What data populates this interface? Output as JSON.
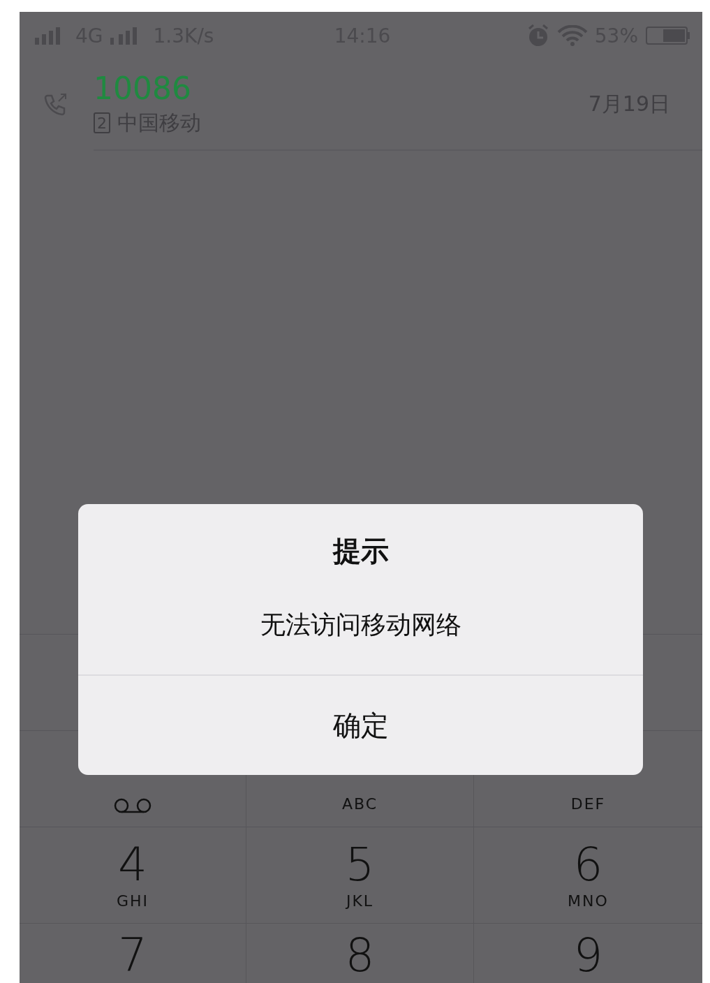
{
  "status_bar": {
    "network": "4G",
    "speed": "1.3K/s",
    "time": "14:16",
    "battery": "53%"
  },
  "call_log": [
    {
      "number": "10086",
      "sim": "2",
      "name": "中国移动",
      "date": "7月19日",
      "kind": "outgoing"
    }
  ],
  "keypad": [
    {
      "kind": "voicemail"
    },
    {
      "letters": "ABC",
      "kind": "digit"
    },
    {
      "letters": "DEF",
      "kind": "digit"
    },
    {
      "digit": "4",
      "letters": "GHI",
      "kind": "digit"
    },
    {
      "digit": "5",
      "letters": "JKL",
      "kind": "digit"
    },
    {
      "digit": "6",
      "letters": "MNO",
      "kind": "digit"
    },
    {
      "digit": "7",
      "kind": "digit"
    },
    {
      "digit": "8",
      "kind": "digit"
    },
    {
      "digit": "9",
      "kind": "digit"
    }
  ],
  "dialog": {
    "title": "提示",
    "message": "无法访问移动网络",
    "button": "确定"
  }
}
